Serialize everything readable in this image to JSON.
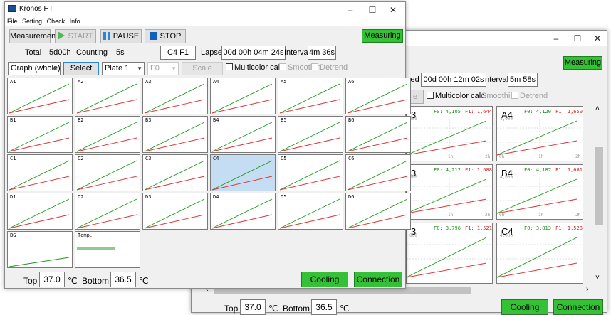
{
  "back": {
    "window_controls": {
      "minimize": "–",
      "maximize": "☐",
      "close": "✕"
    },
    "status_label": "Measuring",
    "lapsed_label_partial": "sed",
    "lapsed_value": "00d 00h 12m 02s",
    "interval_label": "Interval",
    "interval_value": "5m 58s",
    "scale_partial": "e",
    "multicolor_label": "Multicolor calc.",
    "smoothing_label": "Smoothin",
    "detrend_label": "Detrend",
    "panels": [
      {
        "well": "3",
        "f0": "F0: 4,105",
        "f1": "F1: 1,644",
        "ymax": "000",
        "ticks": [
          "1h",
          "2h"
        ]
      },
      {
        "well": "A4",
        "f0": "F0: 4,120",
        "f1": "F1: 1,650",
        "ymax": "4,000",
        "ticks": [
          "0h",
          "1h",
          "2h"
        ]
      },
      {
        "well": "3",
        "f0": "F0: 4,212",
        "f1": "F1: 1,688",
        "ymax": "000",
        "ticks": [
          "1h",
          "2h"
        ]
      },
      {
        "well": "B4",
        "f0": "F0: 4,187",
        "f1": "F1: 1,681",
        "ymax": "4,000",
        "ticks": [
          "0h",
          "1h",
          "2h"
        ]
      },
      {
        "well": "3",
        "f0": "F0: 3,796",
        "f1": "F1: 1,521",
        "ymax": "000",
        "ticks": []
      },
      {
        "well": "C4",
        "f0": "F0: 3,813",
        "f1": "F1: 1,528",
        "ymax": "4,000",
        "ticks": []
      }
    ],
    "scroll_left": "‹",
    "scroll_right": "›",
    "scroll_up": "˄",
    "scroll_down": "˅",
    "top_label": "Top",
    "top_value": "37.0",
    "top_unit": "℃",
    "bottom_label": "Bottom",
    "bottom_value": "36.5",
    "bottom_unit": "℃",
    "cooling_label": "Cooling",
    "connection_label": "Connection"
  },
  "front": {
    "app_title": "Kronos HT",
    "window_controls": {
      "minimize": "–",
      "maximize": "☐",
      "close": "✕"
    },
    "menu": [
      "File",
      "Setting",
      "Check",
      "Info"
    ],
    "toolbar": {
      "measurement_label": "Measurement",
      "start_label": "START",
      "pause_label": "PAUSE",
      "stop_label": "STOP",
      "status_label": "Measuring"
    },
    "info": {
      "total_label": "Total",
      "total_value": "5d00h",
      "counting_label": "Counting",
      "counting_value": "5s",
      "current_well": "C4 F1",
      "lapsed_label": "Lapsed",
      "lapsed_value": "00d 00h 04m 24s",
      "interval_label": "Interval",
      "interval_value": "4m 36s"
    },
    "controls": {
      "view_mode": "Graph (whole)",
      "select_label": "Select",
      "plate": "Plate 1",
      "channel": "F0",
      "scale_label": "Scale",
      "multicolor_label": "Multicolor calc.",
      "smoothing_label": "Smoothin",
      "detrend_label": "Detrend"
    },
    "grid_rows": [
      [
        "A1",
        "A2",
        "A3",
        "A4",
        "A5",
        "A6"
      ],
      [
        "B1",
        "B2",
        "B3",
        "B4",
        "B5",
        "B6"
      ],
      [
        "C1",
        "C2",
        "C3",
        "C4",
        "C5",
        "C6"
      ],
      [
        "D1",
        "D2",
        "D3",
        "D4",
        "D5",
        "D6"
      ]
    ],
    "selected_well": "C4",
    "extra_cells": [
      "BG",
      "Temp."
    ],
    "footer": {
      "top_label": "Top",
      "top_value": "37.0",
      "top_unit": "℃",
      "bottom_label": "Bottom",
      "bottom_value": "36.5",
      "bottom_unit": "℃",
      "cooling_label": "Cooling",
      "connection_label": "Connection"
    },
    "colors": {
      "f0_line": "#1a9a1a",
      "f1_line": "#e03030",
      "start": "#58b558",
      "pause": "#2a86d8",
      "stop": "#1060c0"
    }
  }
}
